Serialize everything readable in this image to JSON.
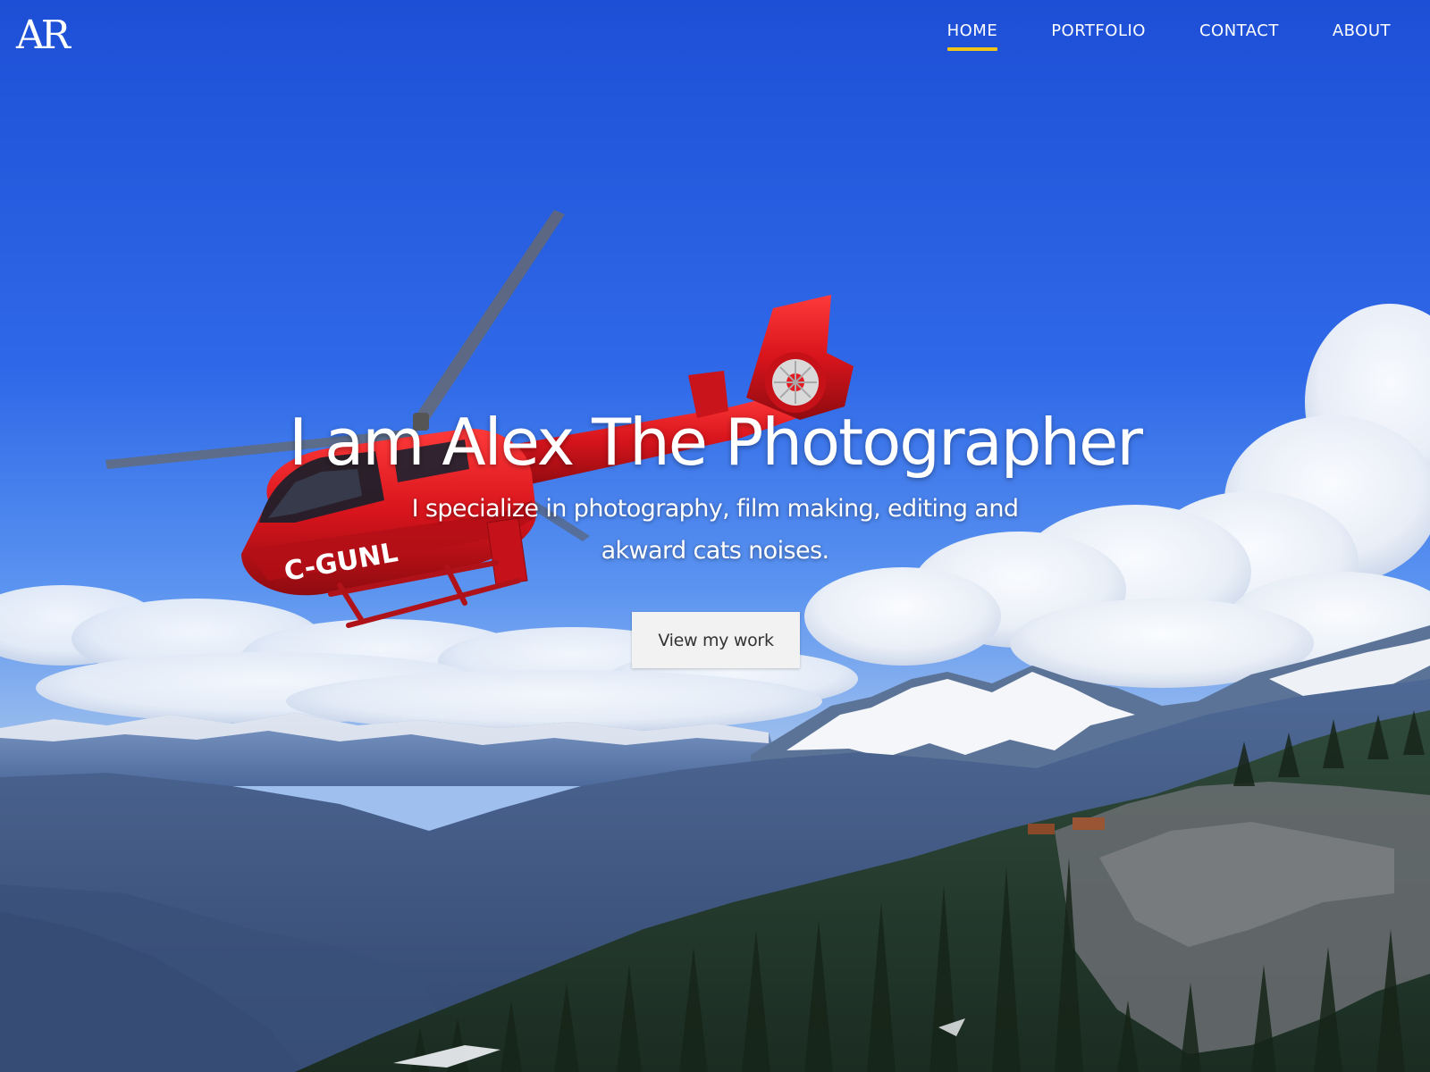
{
  "header": {
    "logo": "AR",
    "nav": [
      {
        "label": "HOME",
        "active": true
      },
      {
        "label": "PORTFOLIO",
        "active": false
      },
      {
        "label": "CONTACT",
        "active": false
      },
      {
        "label": "ABOUT",
        "active": false
      }
    ]
  },
  "hero": {
    "title": "I am Alex The Photographer",
    "subtitle": "I specialize in photography, film making, editing and akward cats noises.",
    "cta_label": "View my work",
    "background_image": {
      "subject": "red helicopter flying over snowy mountain range",
      "tail_registration": "C-GUNL"
    }
  },
  "colors": {
    "nav_active_underline": "#f0c419",
    "text": "#ffffff",
    "cta_background": "#f2f2f2",
    "cta_text": "#333333",
    "sky": "#2c64e6",
    "helicopter": "#d8141c"
  }
}
